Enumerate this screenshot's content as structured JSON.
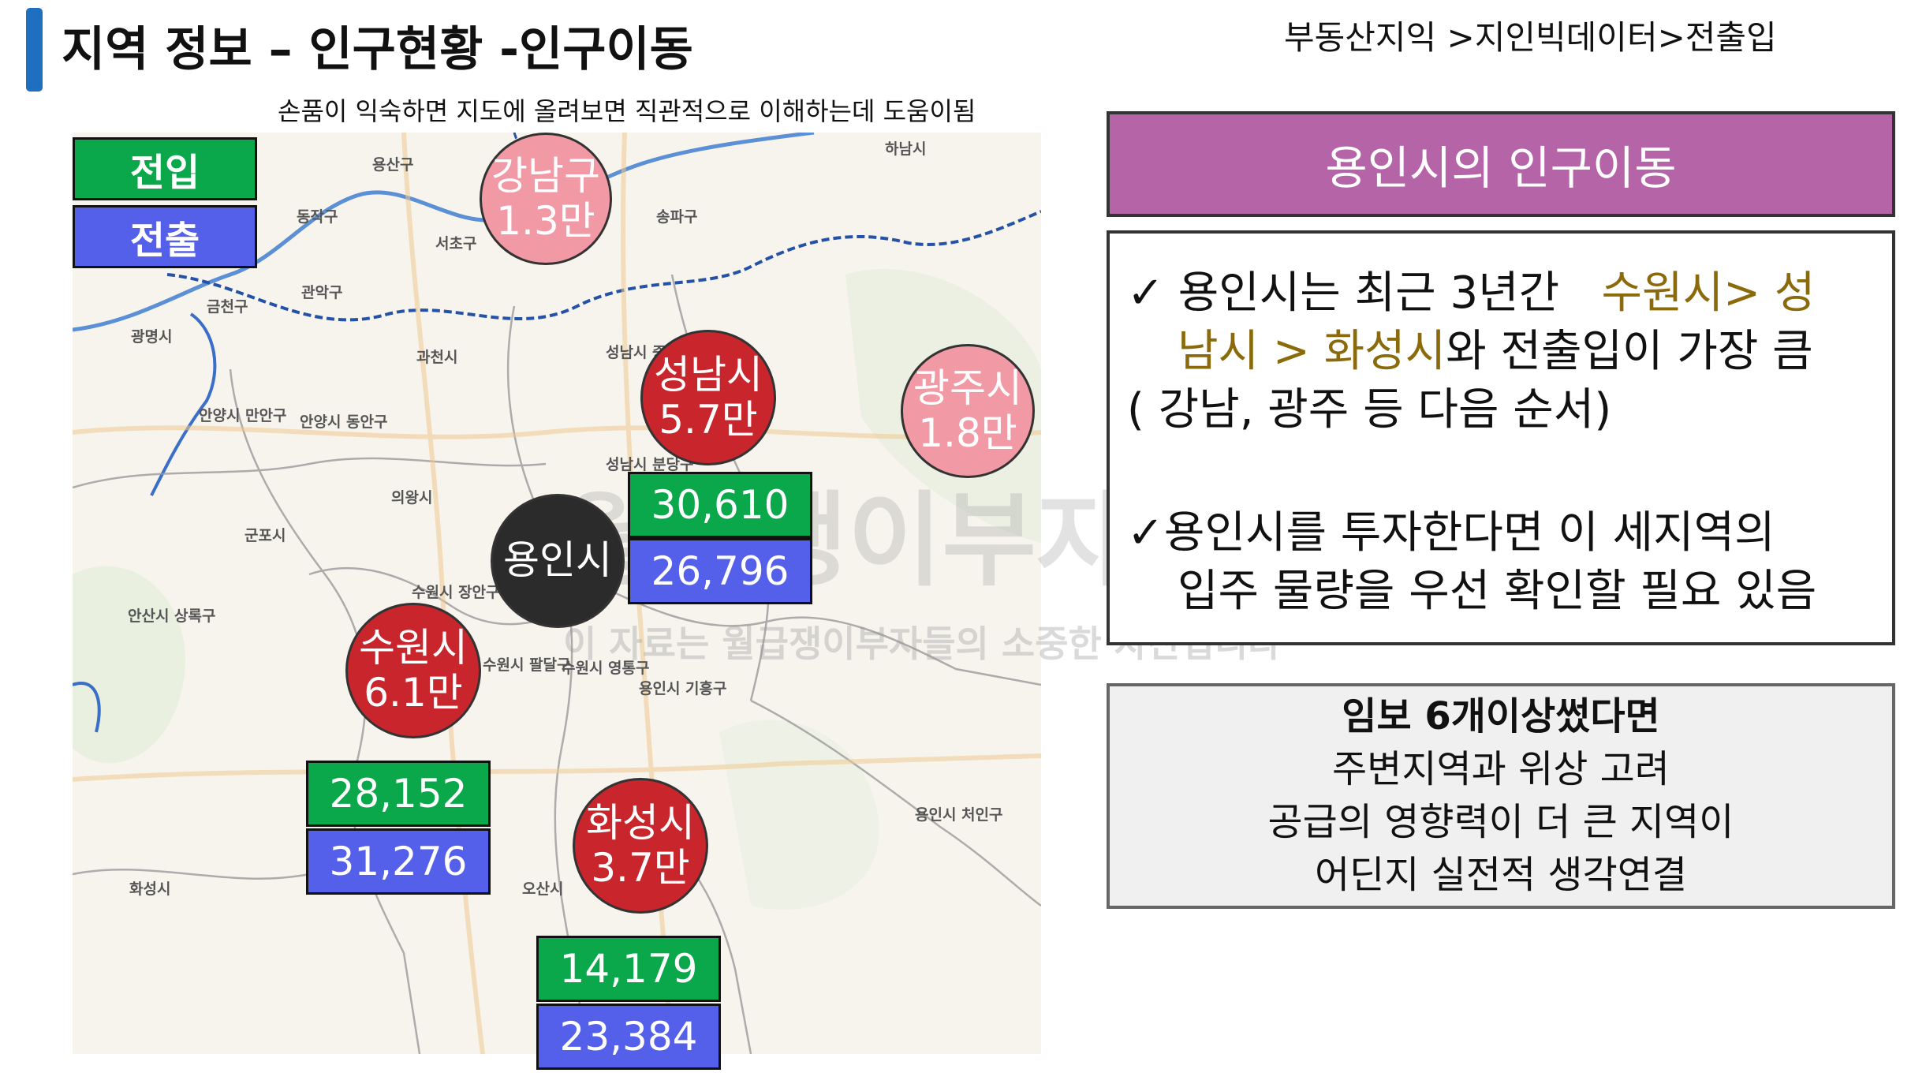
{
  "header": {
    "title": "지역 정보 – 인구현황 -인구이동",
    "breadcrumb": "부동산지익 >지인빅데이터>전출입",
    "subtitle": "손품이 익숙하면 지도에 올려보면 직관적으로 이해하는데 도움이됨"
  },
  "legend": {
    "inflow": "전입",
    "outflow": "전출"
  },
  "map_places": [
    "용산구",
    "하남시",
    "동작구",
    "서초구",
    "송파구",
    "관악구",
    "금천구",
    "광명시",
    "과천시",
    "성남시 중원구",
    "안양시 만안구",
    "안양시 동안구",
    "의왕시",
    "군포시",
    "안산시 상록구",
    "수원시 장안구",
    "수원시 팔달구",
    "수원시 영통구",
    "용인시 기흥구",
    "용인시 처인구",
    "화성시",
    "오산시",
    "성남시 분당구"
  ],
  "circles": {
    "gangnam": {
      "name": "강남구",
      "value": "1.3만"
    },
    "seongnam": {
      "name": "성남시",
      "value": "5.7만"
    },
    "gwangju": {
      "name": "광주시",
      "value": "1.8만"
    },
    "yongin": {
      "name": "용인시"
    },
    "suwon": {
      "name": "수원시",
      "value": "6.1만"
    },
    "hwaseong": {
      "name": "화성시",
      "value": "3.7만"
    }
  },
  "boxes": {
    "seongnam": {
      "in": "30,610",
      "out": "26,796"
    },
    "suwon": {
      "in": "28,152",
      "out": "31,276"
    },
    "hwaseong": {
      "in": "14,179",
      "out": "23,384"
    }
  },
  "watermark": {
    "big": "월급쟁이부자들",
    "small": "이 자료는 월급쟁이부자들의 소중한 자산입니다"
  },
  "panel": {
    "title": "용인시의 인구이동",
    "b1_pre": "✓ 용인시는 최근 3년간",
    "b1_hl1": "수원시> 성",
    "b1_hl2": "남시 > 화성시",
    "b1_post": "와 전출입이 가장 큼",
    "b1_line3": "(  강남, 광주 등 다음 순서)",
    "b2_line1": "✓용인시를 투자한다면 이 세지역의",
    "b2_line2": "입주 물량을 우선 확인할 필요 있음"
  },
  "note": {
    "line1": "임보 6개이상썼다면",
    "line2": "주변지역과 위상 고려",
    "line3": "공급의 영향력이 더  큰 지역이",
    "line4": "어딘지 실전적 생각연결"
  },
  "colors": {
    "accent_bar": "#1e6fc0",
    "inflow": "#0aa84a",
    "outflow": "#5560ea",
    "purple_panel": "#b564a8",
    "pink_circle": "#f19aa5",
    "red_circle": "#c8262c",
    "highlight_text": "#8a6a0a"
  }
}
